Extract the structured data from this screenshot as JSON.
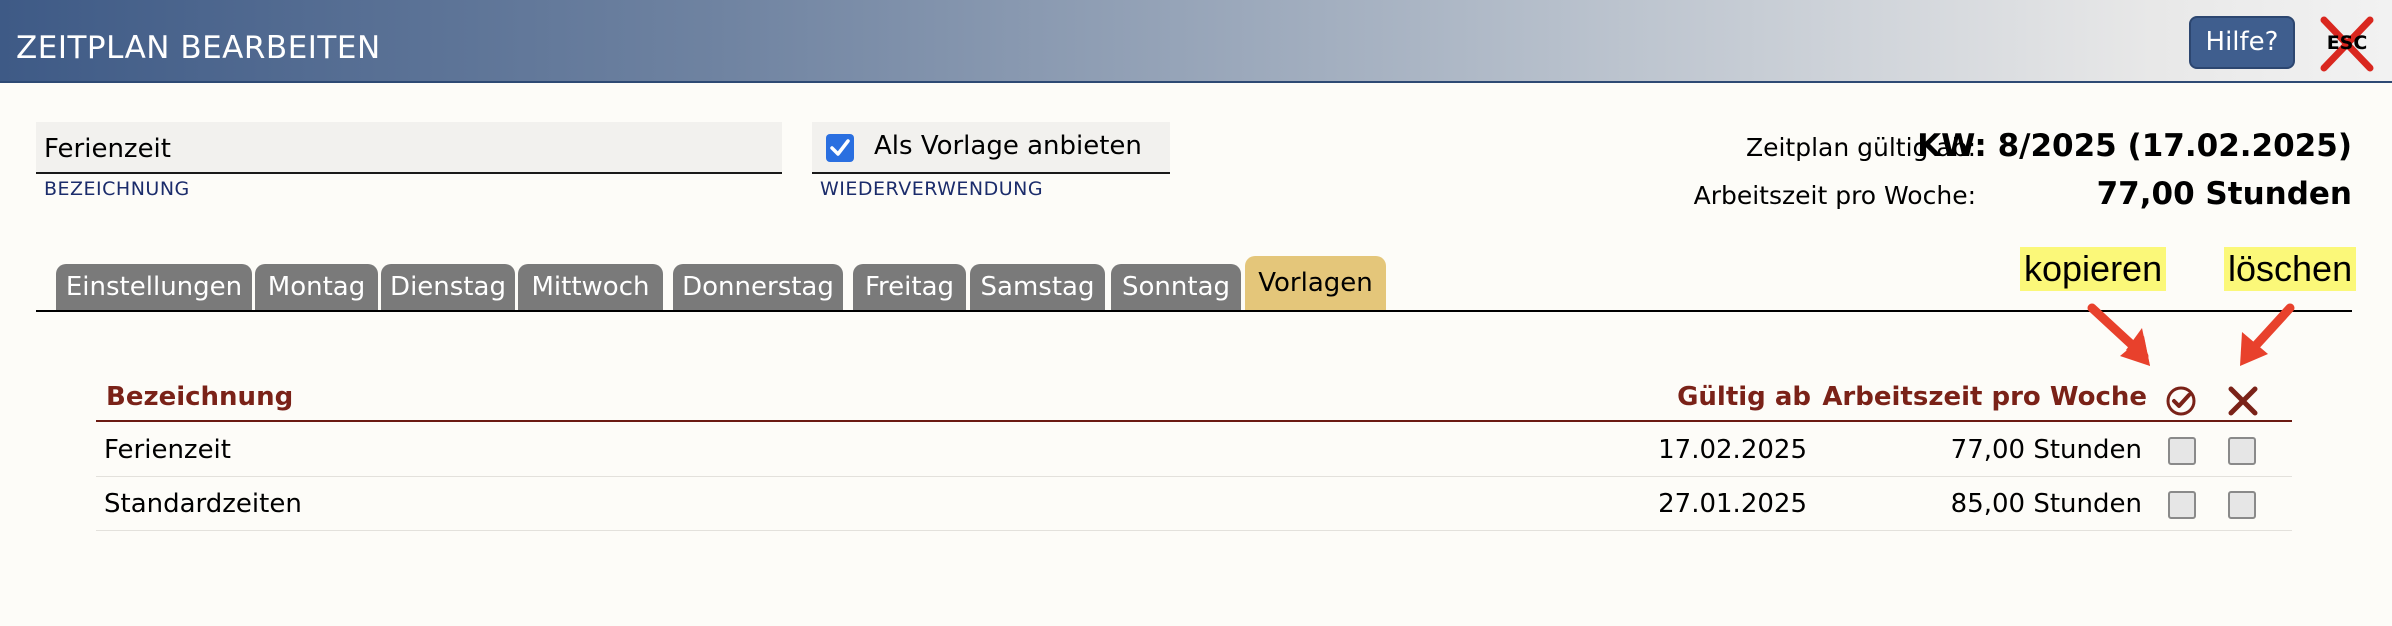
{
  "header": {
    "title": "ZEITPLAN BEARBEITEN",
    "help_label": "Hilfe?",
    "esc_label": "ESC"
  },
  "form": {
    "name_value": "Ferienzeit",
    "name_label": "BEZEICHNUNG",
    "template_checkbox_label": "Als Vorlage anbieten",
    "template_checked": true,
    "template_label": "WIEDERVERWENDUNG"
  },
  "info": {
    "valid_from_label": "Zeitplan gültig ab:",
    "valid_from_value": "KW: 8/2025 (17.02.2025)",
    "hours_label": "Arbeitszeit pro Woche:",
    "hours_value": "77,00 Stunden"
  },
  "tabs": [
    {
      "label": "Einstellungen",
      "active": false
    },
    {
      "label": "Montag",
      "active": false
    },
    {
      "label": "Dienstag",
      "active": false
    },
    {
      "label": "Mittwoch",
      "active": false
    },
    {
      "label": "Donnerstag",
      "active": false
    },
    {
      "label": "Freitag",
      "active": false
    },
    {
      "label": "Samstag",
      "active": false
    },
    {
      "label": "Sonntag",
      "active": false
    },
    {
      "label": "Vorlagen",
      "active": true
    }
  ],
  "annotations": {
    "copy": "kopieren",
    "delete": "löschen"
  },
  "table": {
    "headers": {
      "name": "Bezeichnung",
      "valid_from": "Gültig ab",
      "hours": "Arbeitszeit pro Woche"
    },
    "rows": [
      {
        "name": "Ferienzeit",
        "valid_from": "17.02.2025",
        "hours": "77,00 Stunden",
        "copy_checked": false,
        "delete_checked": false
      },
      {
        "name": "Standardzeiten",
        "valid_from": "27.01.2025",
        "hours": "85,00 Stunden",
        "copy_checked": false,
        "delete_checked": false
      }
    ]
  },
  "colors": {
    "header_start": "#3e5a86",
    "active_tab": "#e4c67a",
    "inactive_tab": "#7a7a7a",
    "table_header_text": "#7a2218",
    "annotation_highlight": "#fbf879",
    "arrow": "#e8412c"
  },
  "icons": {
    "copy_column": "check-circle-icon",
    "delete_column": "x-icon",
    "esc": "close-x-icon"
  }
}
